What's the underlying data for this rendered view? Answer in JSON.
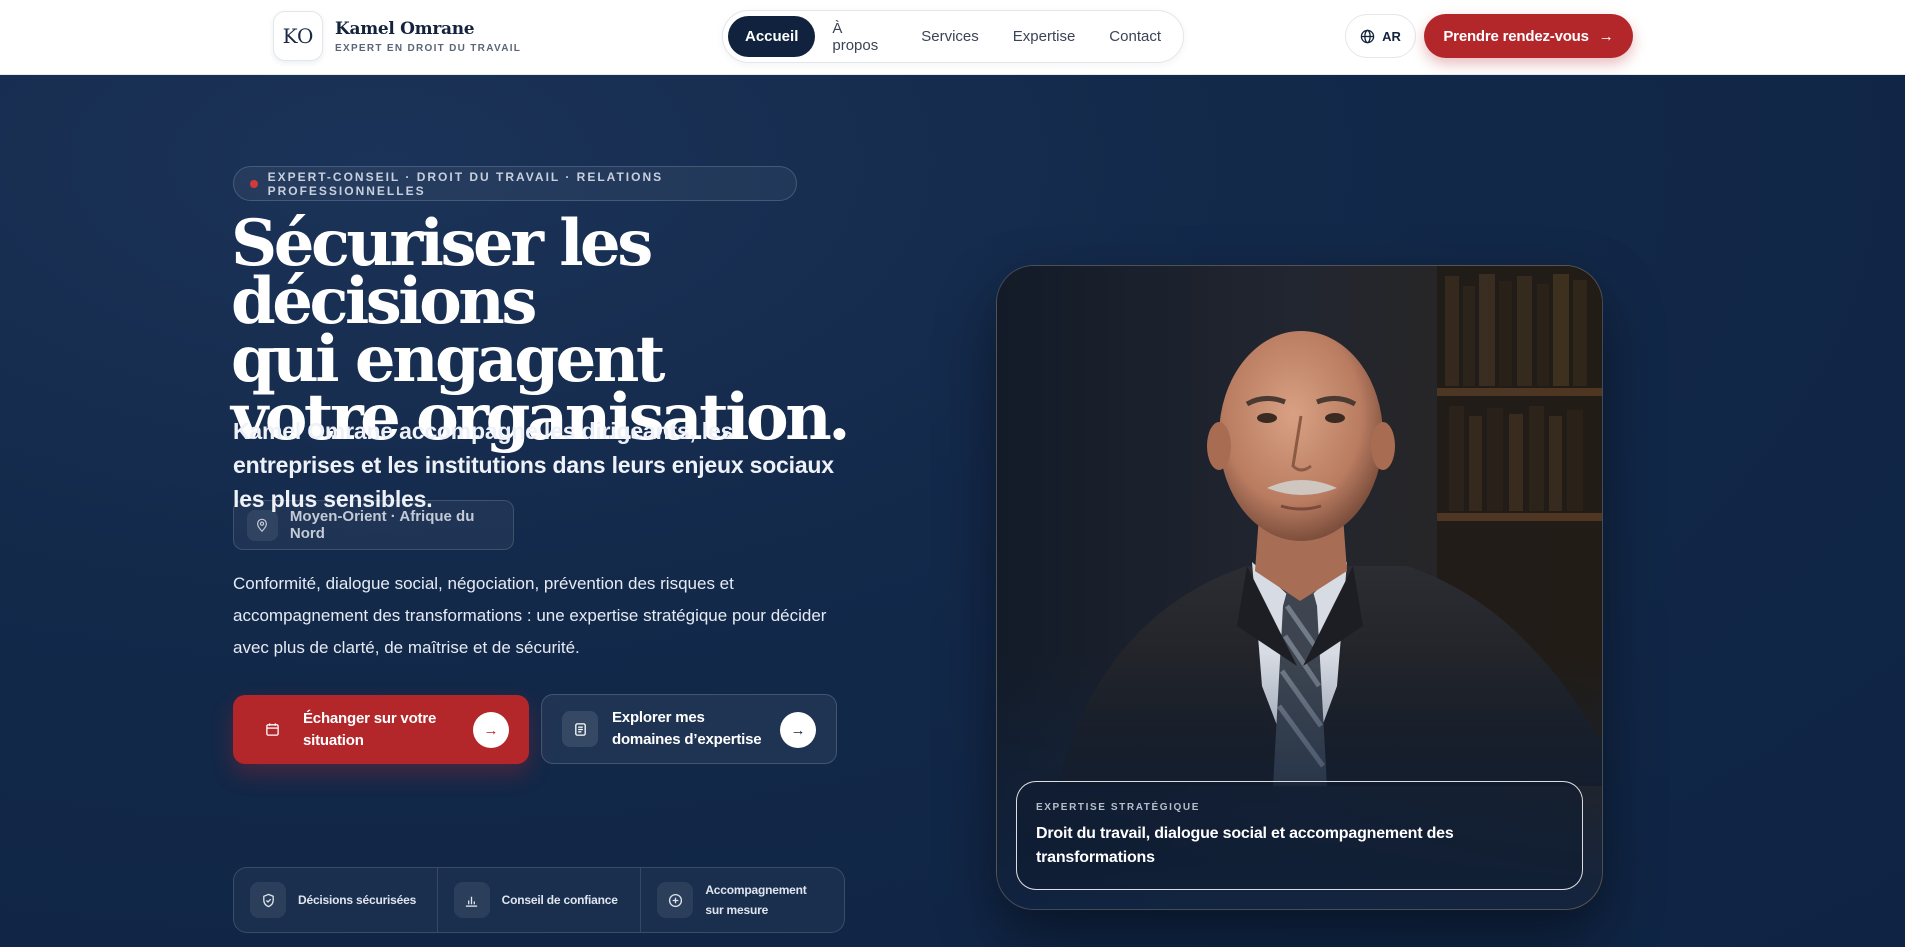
{
  "brand": {
    "logo_text": "KO",
    "name": "Kamel Omrane",
    "subtitle": "EXPERT EN DROIT DU TRAVAIL"
  },
  "nav": {
    "items": [
      {
        "label": "Accueil",
        "active": true
      },
      {
        "label": "À propos",
        "active": false
      },
      {
        "label": "Services",
        "active": false
      },
      {
        "label": "Expertise",
        "active": false
      },
      {
        "label": "Contact",
        "active": false
      }
    ]
  },
  "header_actions": {
    "language_label": "AR",
    "language_icon": "globe-icon",
    "cta_label": "Prendre rendez-vous",
    "cta_icon": "arrow-right-icon"
  },
  "hero": {
    "eyebrow": "EXPERT-CONSEIL · DROIT DU TRAVAIL · RELATIONS PROFESSIONNELLES",
    "title_lines": [
      "Sécuriser les décisions",
      "qui engagent",
      "votre organisation."
    ],
    "lead": "Kamel Omrane accompagne les dirigeants, les entreprises et les institutions dans leurs enjeux sociaux les plus sensibles.",
    "region": {
      "icon": "map-pin-icon",
      "label": "Moyen-Orient · Afrique du Nord"
    },
    "description": "Conformité, dialogue social, négociation, prévention des risques et accompagnement des transformations : une expertise stratégique pour décider avec plus de clarté, de maîtrise et de sécurité.",
    "primary_button": {
      "icon": "calendar-icon",
      "label": "Échanger sur votre situation"
    },
    "secondary_button": {
      "icon": "document-icon",
      "label": "Explorer mes domaines d’expertise"
    },
    "features": [
      {
        "icon": "shield-icon",
        "label": "Décisions sécurisées"
      },
      {
        "icon": "bar-chart-icon",
        "label": "Conseil de confiance"
      },
      {
        "icon": "plus-circle-icon",
        "label": "Accompagnement sur mesure"
      }
    ]
  },
  "portrait": {
    "caption_kicker": "EXPERTISE STRATÉGIQUE",
    "caption_text": "Droit du travail, dialogue social et accompagnement des transformations"
  },
  "colors": {
    "navy": "#0f2444",
    "accent_red": "#b3262a",
    "white": "#ffffff"
  }
}
